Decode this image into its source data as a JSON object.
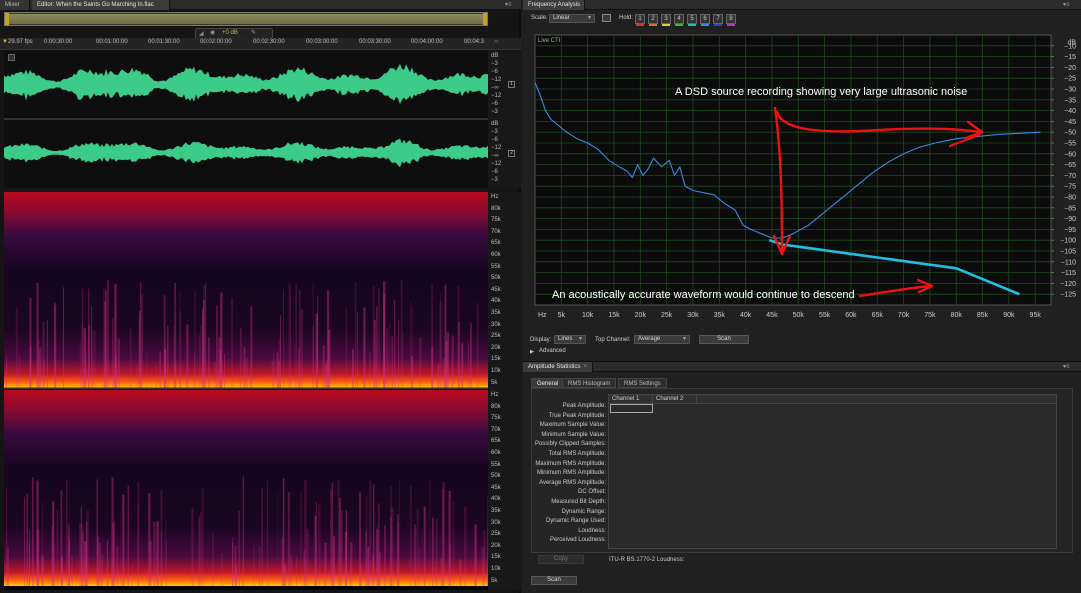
{
  "left_panel": {
    "tabs": [
      {
        "label": "Mixer"
      },
      {
        "label": "Editor: When the Saints Go Marching In.flac"
      }
    ],
    "fps_label": "29.97 fps",
    "hud_gain": "+0 dB",
    "ruler_ticks": [
      "0:00:30:00",
      "00:01:00:00",
      "00:01:30:00",
      "00:02:00:00",
      "00:02:30:00",
      "00:03:00:00",
      "00:03:30:00",
      "00:04:00:00",
      "00:04:3"
    ],
    "db_scale": [
      "dB",
      "−3",
      "−6",
      "−12",
      "−∞",
      "−12",
      "−6",
      "−3"
    ],
    "channel_badges": [
      "1",
      "2"
    ],
    "hz_scale": [
      "Hz",
      "80k",
      "75k",
      "70k",
      "65k",
      "60k",
      "55k",
      "50k",
      "45k",
      "40k",
      "35k",
      "30k",
      "25k",
      "20k",
      "15k",
      "10k",
      "5k"
    ],
    "colors": {
      "waveform": "#3fd68f",
      "spectral_hot": "#ffd000",
      "spectral_mid": "#c0102a",
      "spectral_low": "#2a0a4a"
    }
  },
  "frequency_analysis": {
    "tab_label": "Frequency Analysis",
    "scale_label": "Scale:",
    "scale_value": "Linear",
    "hold_label": "Hold:",
    "hold_buttons": [
      {
        "label": "1",
        "color": "#e03030"
      },
      {
        "label": "2",
        "color": "#e07020"
      },
      {
        "label": "3",
        "color": "#e0d020"
      },
      {
        "label": "4",
        "color": "#30c030"
      },
      {
        "label": "5",
        "color": "#20c0a0"
      },
      {
        "label": "6",
        "color": "#3090e0"
      },
      {
        "label": "7",
        "color": "#3040d0"
      },
      {
        "label": "8",
        "color": "#c030c0"
      }
    ],
    "display_label": "Display:",
    "display_value": "Lines",
    "top_channel_label": "Top Channel:",
    "top_channel_value": "Average",
    "scan_label": "Scan",
    "advanced_label": "Advanced"
  },
  "chart_data": {
    "type": "line",
    "title": "",
    "corner_label": "Live CTI",
    "xlabel": "",
    "ylabel": "",
    "x_ticks": [
      "Hz",
      "5k",
      "10k",
      "15k",
      "20k",
      "25k",
      "30k",
      "35k",
      "40k",
      "45k",
      "50k",
      "55k",
      "60k",
      "65k",
      "70k",
      "75k",
      "80k",
      "85k",
      "90k",
      "95k"
    ],
    "y_ticks": [
      "dB",
      "−10",
      "−15",
      "−20",
      "−25",
      "−30",
      "−35",
      "−40",
      "−45",
      "−50",
      "−55",
      "−60",
      "−65",
      "−70",
      "−75",
      "−80",
      "−85",
      "−90",
      "−95",
      "−100",
      "−105",
      "−110",
      "−115",
      "−120",
      "−125"
    ],
    "xlim": [
      0,
      98000
    ],
    "ylim": [
      -130,
      -5
    ],
    "grid": true,
    "series": [
      {
        "color": "#3c88e0",
        "x": [
          0,
          1000,
          2000,
          3000,
          4500,
          6000,
          8000,
          10000,
          12000,
          14000,
          16000,
          17500,
          18500,
          19500,
          20500,
          21500,
          22500,
          24000,
          25500,
          26500,
          27500,
          28500,
          30000,
          32000,
          34000,
          36000,
          38000,
          39500,
          41000,
          43000,
          45000,
          47000,
          49000,
          52000,
          55000,
          58000,
          61000,
          64000,
          67000,
          70000,
          73000,
          76000,
          80000,
          84000,
          88000,
          92000,
          96000
        ],
        "y": [
          -27,
          -33,
          -40,
          -44,
          -47,
          -50,
          -53,
          -55,
          -58,
          -63,
          -66,
          -68,
          -71,
          -65,
          -70,
          -67,
          -62,
          -66,
          -63,
          -70,
          -66,
          -75,
          -77,
          -78,
          -79,
          -83,
          -86,
          -93,
          -95,
          -97,
          -99,
          -99,
          -97,
          -93,
          -87,
          -81,
          -75,
          -69,
          -64,
          -60,
          -57,
          -55,
          -53,
          -52,
          -51,
          -50.5,
          -50
        ]
      },
      {
        "color": "#22c0e0",
        "x": [
          44500,
          47000,
          50000,
          53000,
          56000,
          59000,
          62000,
          65000,
          68000,
          71000,
          74000,
          77000,
          80000,
          82000,
          84000,
          86000,
          88000,
          90000,
          92000
        ],
        "y": [
          -100,
          -102,
          -103,
          -104,
          -105,
          -106,
          -107,
          -108,
          -109,
          -110,
          -111,
          -112,
          -113,
          -115,
          -117,
          -119,
          -121,
          -123,
          -125
        ]
      }
    ],
    "annotations": [
      "A DSD source recording showing very large ultrasonic noise",
      "An acoustically accurate waveform would continue to descend"
    ]
  },
  "amplitude_statistics": {
    "tab_label": "Amplitude Statistics",
    "sub_tabs": [
      {
        "label": "General"
      },
      {
        "label": "RMS Histogram"
      },
      {
        "label": "RMS Settings"
      }
    ],
    "columns": [
      "Channel 1",
      "Channel 2"
    ],
    "rows": [
      "Peak Amplitude:",
      "True Peak Amplitude:",
      "Maximum Sample Value:",
      "Minimum Sample Value:",
      "Possibly Clipped Samples:",
      "Total RMS Amplitude:",
      "Maximum RMS Amplitude:",
      "Minimum RMS Amplitude:",
      "Average RMS Amplitude:",
      "DC Offset:",
      "Measured Bit Depth:",
      "Dynamic Range:",
      "Dynamic Range Used:",
      "Loudness:",
      "Perceived Loudness:"
    ],
    "copy_label": "Copy",
    "itu_label": "ITU-R BS.1770-2 Loudness:",
    "scan_label": "Scan"
  }
}
